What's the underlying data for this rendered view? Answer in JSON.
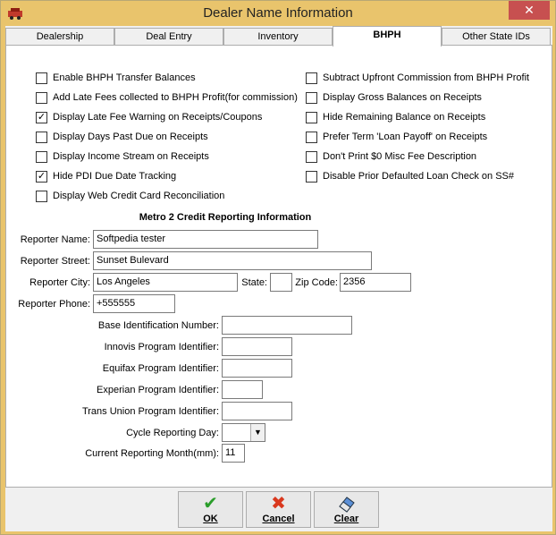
{
  "window": {
    "title": "Dealer Name Information",
    "close_glyph": "✕"
  },
  "tabs": [
    "Dealership",
    "Deal Entry",
    "Inventory",
    "BHPH",
    "Other State IDs"
  ],
  "options_left": [
    {
      "label": "Enable BHPH Transfer Balances",
      "checked": false
    },
    {
      "label": "Add Late Fees collected to BHPH Profit(for commission)",
      "checked": false
    },
    {
      "label": "Display Late Fee Warning on Receipts/Coupons",
      "checked": true
    },
    {
      "label": "Display Days Past Due on Receipts",
      "checked": false
    },
    {
      "label": "Display Income Stream on Receipts",
      "checked": false
    },
    {
      "label": "Hide PDI Due Date Tracking",
      "checked": true
    },
    {
      "label": "Display Web Credit Card Reconciliation",
      "checked": false
    }
  ],
  "options_right": [
    {
      "label": "Subtract Upfront Commission from BHPH Profit",
      "checked": false
    },
    {
      "label": "Display Gross Balances on Receipts",
      "checked": false
    },
    {
      "label": "Hide Remaining Balance on Receipts",
      "checked": false
    },
    {
      "label": "Prefer Term 'Loan Payoff' on Receipts",
      "checked": false
    },
    {
      "label": "Don't Print $0 Misc Fee Description",
      "checked": false
    },
    {
      "label": "Disable Prior Defaulted Loan Check on SS#",
      "checked": false
    }
  ],
  "metro2": {
    "title": "Metro 2 Credit Reporting Information",
    "reporter_name_label": "Reporter Name:",
    "reporter_name": "Softpedia tester",
    "reporter_street_label": "Reporter Street:",
    "reporter_street": "Sunset Bulevard",
    "reporter_city_label": "Reporter City:",
    "reporter_city": "Los Angeles",
    "state_label": "State:",
    "state": "",
    "zip_label": "Zip Code:",
    "zip": "2356",
    "reporter_phone_label": "Reporter Phone:",
    "reporter_phone": "+555555",
    "base_id_label": "Base Identification Number:",
    "base_id": "",
    "innovis_label": "Innovis Program Identifier:",
    "innovis": "",
    "equifax_label": "Equifax Program Identifier:",
    "equifax": "",
    "experian_label": "Experian Program Identifier:",
    "experian": "",
    "transunion_label": "Trans Union Program Identifier:",
    "transunion": "",
    "cycle_day_label": "Cycle Reporting Day:",
    "cycle_day": "",
    "current_month_label": "Current Reporting Month(mm):",
    "current_month": "11"
  },
  "buttons": {
    "ok": "OK",
    "cancel": "Cancel",
    "clear": "Clear"
  },
  "colors": {
    "titlebar": "#e9c46c",
    "close": "#c75050",
    "ok_icon": "#2a9d2a",
    "cancel_icon": "#d9381e"
  }
}
